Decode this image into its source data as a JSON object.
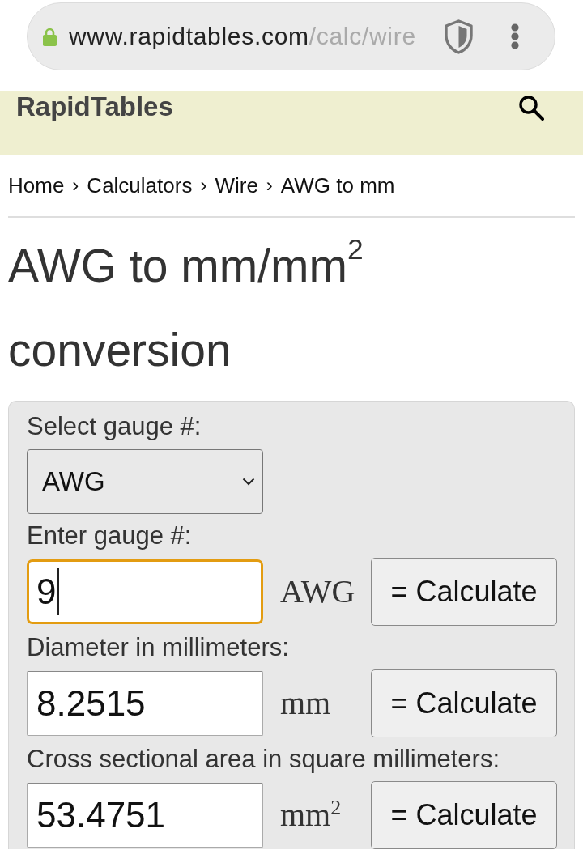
{
  "browser": {
    "url_domain": "www.rapidtables.com",
    "url_path": "/calc/wire"
  },
  "header": {
    "logo": "RapidTables"
  },
  "breadcrumb": [
    {
      "label": "Home"
    },
    {
      "separator": "›",
      "label": "Calculators"
    },
    {
      "separator": "›",
      "label": "Wire"
    },
    {
      "separator": "›",
      "label": "AWG to mm"
    }
  ],
  "title": "AWG to mm/mm$^{2}$ conversion",
  "calculator": {
    "fields": [
      {
        "kind": "select",
        "label": "Select gauge #:",
        "value": "AWG"
      },
      {
        "kind": "input",
        "label": "Enter gauge #:",
        "value": "9",
        "focused": true,
        "unit": "AWG",
        "button": "= Calculate"
      },
      {
        "kind": "input",
        "label": "Diameter in millimeters:",
        "value": "8.2515",
        "focused": false,
        "unit": "mm",
        "button": "= Calculate"
      },
      {
        "kind": "input",
        "label": "Cross sectional area in square millimeters:",
        "value": "53.4751",
        "focused": false,
        "unit": "mm$^{2}$",
        "button": "= Calculate"
      }
    ]
  }
}
